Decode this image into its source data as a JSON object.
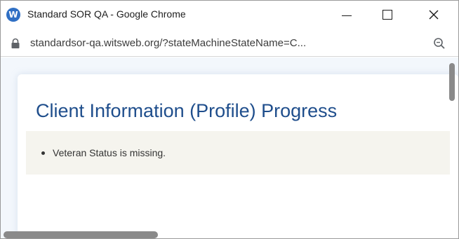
{
  "window": {
    "title": "Standard SOR QA - Google Chrome",
    "app_icon_letter": "W"
  },
  "address_bar": {
    "url": "standardsor-qa.witsweb.org/?stateMachineStateName=C..."
  },
  "page": {
    "heading": "Client Information (Profile) Progress",
    "messages": [
      {
        "text": "Veteran Status is missing."
      }
    ]
  },
  "colors": {
    "heading": "#1f4e8c",
    "message_panel": "#f5f4ee",
    "page_background": "#f3f7fc",
    "app_icon": "#2f6fc4"
  }
}
